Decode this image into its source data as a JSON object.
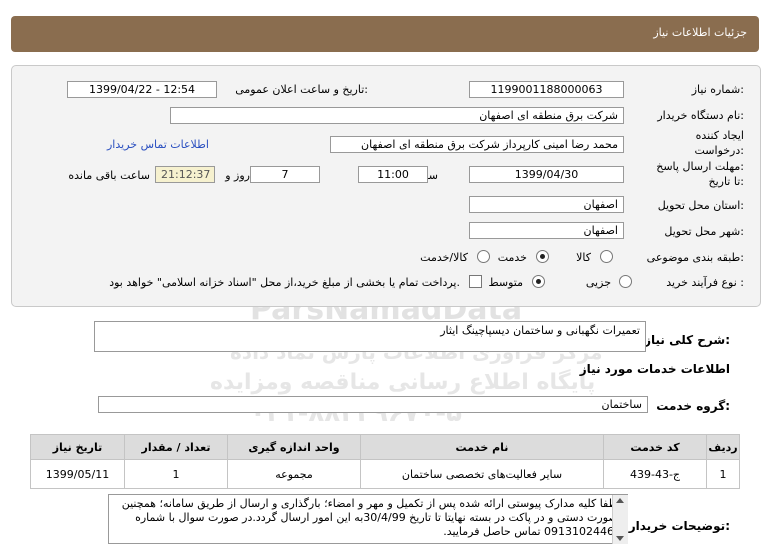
{
  "header": {
    "title": "جزئیات اطلاعات نیاز"
  },
  "form": {
    "need_number_label": "شماره نیاز:",
    "need_number": "1199001188000063",
    "announce_label": "تاریخ و ساعت اعلان عمومی:",
    "announce_value": "1399/04/22 - 12:54",
    "buyer_label": "نام دستگاه خریدار:",
    "buyer_value": "شرکت برق منطقه ای اصفهان",
    "creator_label_1": "ایجاد کننده",
    "creator_label_2": "درخواست:",
    "creator_value": "محمد رضا امینی کارپرداز شرکت برق منطقه ای اصفهان",
    "contact_link": "اطلاعات تماس خریدار",
    "deadline_label_1": "مهلت ارسال پاسخ:",
    "deadline_label_2": "تا تاریخ:",
    "deadline_date": "1399/04/30",
    "time_label": "ساعت",
    "deadline_time": "11:00",
    "days_value": "7",
    "days_label": "روز و",
    "remaining_time": "21:12:37",
    "remaining_label": "ساعت باقی مانده",
    "province_label": "استان محل تحویل:",
    "province_value": "اصفهان",
    "city_label": "شهر محل تحویل:",
    "city_value": "اصفهان",
    "category_label": "طبقه بندی موضوعی:",
    "category_options": [
      "کالا",
      "خدمت",
      "کالا/خدمت"
    ],
    "category_selected": "خدمت",
    "process_label": "نوع فرآیند خرید :",
    "process_options": [
      "جزیی",
      "متوسط"
    ],
    "process_selected": "متوسط",
    "payment_note": "پرداخت تمام یا بخشی از مبلغ خرید،از محل \"اسناد خزانه اسلامی\" خواهد بود."
  },
  "summary": {
    "label": "شرح کلی نیاز:",
    "value": "تعمیرات نگهبانی و ساختمان دیسپاچینگ ایثار"
  },
  "services_heading": "اطلاعات خدمات مورد نیاز",
  "service_group": {
    "label": "گروه خدمت:",
    "value": "ساختمان"
  },
  "table": {
    "headers": [
      "ردیف",
      "کد خدمت",
      "نام خدمت",
      "واحد اندازه گیری",
      "تعداد / مقدار",
      "تاریخ نیاز"
    ],
    "rows": [
      [
        "1",
        "ج-43-439",
        "سایر فعالیت‌های تخصصی ساختمان",
        "مجموعه",
        "1",
        "1399/05/11"
      ]
    ]
  },
  "notes": {
    "label": "توضیحات خریدار:",
    "text": "لطفا کلیه مدارک پیوستی ارائه شده  پس از تکمیل و مهر و امضاء؛ بارگذاری و ارسال از طریق سامانه؛ همچنین بصورت دستی و در پاکت در بسته نهایتا تا تاریخ 30/4/99به این امور ارسال گردد.در صورت سوال با شماره 09131024462 تماس حاصل فرمایید."
  },
  "watermark": {
    "brand": "ParsNamadData",
    "line1": "مرکز فراوری اطلاعات پارس نماد داده",
    "line2": "پایگاه اطلاع رسانی مناقصه ومزایده",
    "phone": "۰۲۱-۸۸۳۴۹۶۷۰-۵"
  },
  "colors": {
    "header_bg": "#8a6d4f",
    "link": "#2a4fc0",
    "time_bg": "#f6f1cf"
  }
}
